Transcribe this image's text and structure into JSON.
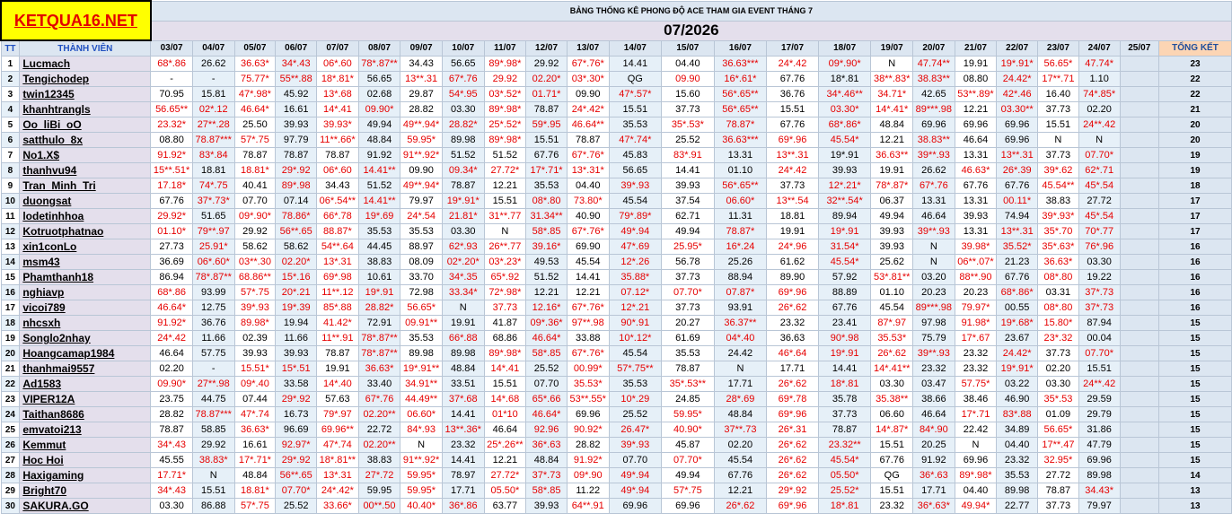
{
  "site_logo": "KETQUA16.NET",
  "subtitle": "BẢNG THỐNG KÊ PHONG ĐỘ ACE THAM GIA EVENT THÁNG 7",
  "month": "07/2026",
  "headers": {
    "tt": "TT",
    "member": "THÀNH VIÊN",
    "dates": [
      "03/07",
      "04/07",
      "05/07",
      "06/07",
      "07/07",
      "08/07",
      "09/07",
      "10/07",
      "11/07",
      "12/07",
      "13/07",
      "14/07",
      "15/07",
      "16/07",
      "17/07",
      "18/07",
      "19/07",
      "20/07",
      "21/07",
      "22/07",
      "23/07",
      "24/07",
      "25/07"
    ],
    "total": "TỔNG KẾT"
  },
  "colors": {
    "red": "#e60000",
    "black": "#000000",
    "header_blue": "#2050c0",
    "name_bg": "#e4dfec",
    "logo_bg": "#ffff00"
  },
  "rows": [
    {
      "tt": "1",
      "name": "Lucmach",
      "total": "23",
      "cells": [
        "r:68*.86",
        "k:26.62",
        "r:36.63*",
        "r:34*.43",
        "r:06*.60",
        "r:78*.87**",
        "k:34.43",
        "k:56.65",
        "r:89*.98*",
        "k:29.92",
        "r:67*.76*",
        "k:14.41",
        "k:04.40",
        "r:36.63***",
        "r:24*.42",
        "r:09*.90*",
        "k:N",
        "r:47.74**",
        "k:19.91",
        "r:19*.91*",
        "r:56.65*",
        "r:47.74*"
      ]
    },
    {
      "tt": "2",
      "name": "Tengichodep",
      "total": "22",
      "cells": [
        "k:-",
        "k:-",
        "r:75.77*",
        "r:55**.88",
        "r:18*.81*",
        "k:56.65",
        "r:13**.31",
        "r:67*.76",
        "r:29.92",
        "r:02.20*",
        "r:03*.30*",
        "k:QG",
        "r:09.90",
        "r:16*.61*",
        "k:67.76",
        "k:18*.81",
        "r:38**.83*",
        "r:38.83**",
        "k:08.80",
        "r:24.42*",
        "r:17**.71",
        "k:1.10"
      ]
    },
    {
      "tt": "3",
      "name": "twin12345",
      "total": "22",
      "cells": [
        "k:70.95",
        "k:15.81",
        "r:47*.98*",
        "k:45.92",
        "r:13*.68",
        "k:02.68",
        "k:29.87",
        "r:54*.95",
        "r:03*.52*",
        "r:01.71*",
        "k:09.90",
        "r:47*.57*",
        "k:15.60",
        "r:56*.65**",
        "k:36.76",
        "r:34*.46**",
        "r:34.71*",
        "k:42.65",
        "r:53**.89*",
        "r:42*.46",
        "k:16.40",
        "r:74*.85*"
      ]
    },
    {
      "tt": "4",
      "name": "khanhtrangls",
      "total": "21",
      "cells": [
        "r:56.65**",
        "r:02*.12",
        "r:46.64*",
        "k:16.61",
        "r:14*.41",
        "r:09.90*",
        "k:28.82",
        "k:03.30",
        "r:89*.98*",
        "k:78.87",
        "r:24*.42*",
        "k:15.51",
        "k:37.73",
        "r:56*.65**",
        "k:15.51",
        "r:03.30*",
        "r:14*.41*",
        "r:89***.98",
        "k:12.21",
        "r:03.30**",
        "k:37.73",
        "k:02.20"
      ]
    },
    {
      "tt": "5",
      "name": "Oo_liBi_oO",
      "total": "20",
      "cells": [
        "r:23.32*",
        "r:27**.28",
        "k:25.50",
        "k:39.93",
        "r:39.93*",
        "k:49.94",
        "r:49**.94*",
        "r:28.82*",
        "r:25*.52*",
        "r:59*.95",
        "r:46.64**",
        "k:35.53",
        "r:35*.53*",
        "r:78.87*",
        "k:67.76",
        "r:68*.86*",
        "k:48.84",
        "k:69.96",
        "k:69.96",
        "k:69.96",
        "k:15.51",
        "r:24**.42"
      ]
    },
    {
      "tt": "6",
      "name": "satthulo_8x",
      "total": "20",
      "cells": [
        "k:08.80",
        "r:78.87***",
        "r:57*.75",
        "k:97.79",
        "r:11**.66*",
        "k:48.84",
        "r:59.95*",
        "k:89.98",
        "r:89*.98*",
        "k:15.51",
        "k:78.87",
        "r:47*.74*",
        "k:25.52",
        "r:36.63***",
        "r:69*.96",
        "r:45.54*",
        "k:12.21",
        "r:38.83**",
        "k:46.64",
        "k:69.96",
        "k:N",
        "k:N"
      ]
    },
    {
      "tt": "7",
      "name": "No1.X$",
      "total": "19",
      "cells": [
        "r:91.92*",
        "r:83*.84",
        "k:78.87",
        "k:78.87",
        "k:78.87",
        "k:91.92",
        "r:91**.92*",
        "k:51.52",
        "k:51.52",
        "k:67.76",
        "r:67*.76*",
        "k:45.83",
        "r:83*.91",
        "k:13.31",
        "r:13**.31",
        "k:19*.91",
        "r:36.63**",
        "r:39**.93",
        "k:13.31",
        "r:13**.31",
        "k:37.73",
        "r:07.70*"
      ]
    },
    {
      "tt": "8",
      "name": "thanhvu94",
      "total": "19",
      "cells": [
        "r:15**.51*",
        "k:18.81",
        "r:18.81*",
        "r:29*.92",
        "r:06*.60",
        "r:14.41**",
        "k:09.90",
        "r:09.34*",
        "r:27.72*",
        "r:17*.71*",
        "r:13*.31*",
        "k:56.65",
        "k:14.41",
        "k:01.10",
        "r:24*.42",
        "k:39.93",
        "k:19.91",
        "k:26.62",
        "r:46.63*",
        "r:26*.39",
        "r:39*.62",
        "r:62*.71"
      ]
    },
    {
      "tt": "9",
      "name": "Tran_Minh_Tri",
      "total": "18",
      "cells": [
        "r:17.18*",
        "r:74*.75",
        "k:40.41",
        "r:89*.98",
        "k:34.43",
        "k:51.52",
        "r:49**.94*",
        "k:78.87",
        "k:12.21",
        "k:35.53",
        "k:04.40",
        "r:39*.93",
        "k:39.93",
        "r:56*.65**",
        "k:37.73",
        "r:12*.21*",
        "r:78*.87*",
        "r:67*.76",
        "k:67.76",
        "k:67.76",
        "r:45.54**",
        "r:45*.54"
      ]
    },
    {
      "tt": "10",
      "name": "duongsat",
      "total": "17",
      "cells": [
        "k:67.76",
        "r:37*.73*",
        "k:07.70",
        "k:07.14",
        "r:06*.54**",
        "r:14.41**",
        "k:79.97",
        "r:19*.91*",
        "k:15.51",
        "r:08*.80",
        "r:73.80*",
        "k:45.54",
        "k:37.54",
        "r:06.60*",
        "r:13**.54",
        "r:32**.54*",
        "k:06.37",
        "k:13.31",
        "k:13.31",
        "r:00.11*",
        "k:38.83",
        "k:27.72"
      ]
    },
    {
      "tt": "11",
      "name": "lodetinhhoa",
      "total": "17",
      "cells": [
        "r:29.92*",
        "k:51.65",
        "r:09*.90*",
        "r:78.86*",
        "r:66*.78",
        "r:19*.69",
        "r:24*.54",
        "r:21.81*",
        "r:31**.77",
        "r:31.34**",
        "k:40.90",
        "r:79*.89*",
        "k:62.71",
        "k:11.31",
        "k:18.81",
        "k:89.94",
        "k:49.94",
        "k:46.64",
        "k:39.93",
        "k:74.94",
        "r:39*.93*",
        "r:45*.54"
      ]
    },
    {
      "tt": "12",
      "name": "Kotruotphatnao",
      "total": "17",
      "cells": [
        "r:01.10*",
        "r:79**.97",
        "k:29.92",
        "r:56**.65",
        "r:88.87*",
        "k:35.53",
        "k:35.53",
        "k:03.30",
        "k:N",
        "r:58*.85",
        "r:67*.76*",
        "r:49*.94",
        "k:49.94",
        "r:78.87*",
        "k:19.91",
        "r:19*.91",
        "k:39.93",
        "r:39**.93",
        "k:13.31",
        "r:13**.31",
        "r:35*.70",
        "r:70*.77"
      ]
    },
    {
      "tt": "13",
      "name": "xin1conLo",
      "total": "16",
      "cells": [
        "k:27.73",
        "r:25.91*",
        "k:58.62",
        "k:58.62",
        "r:54**.64",
        "k:44.45",
        "k:88.97",
        "r:62*.93",
        "r:26**.77",
        "r:39.16*",
        "k:69.90",
        "r:47*.69",
        "r:25.95*",
        "r:16*.24",
        "r:24*.96",
        "r:31.54*",
        "k:39.93",
        "k:N",
        "r:39.98*",
        "r:35.52*",
        "r:35*.63*",
        "r:76*.96"
      ]
    },
    {
      "tt": "14",
      "name": "msm43",
      "total": "16",
      "cells": [
        "k:36.69",
        "r:06*.60*",
        "r:03**.30",
        "r:02.20*",
        "r:13*.31",
        "k:38.83",
        "k:08.09",
        "r:02*.20*",
        "r:03*.23*",
        "k:49.53",
        "k:45.54",
        "r:12*.26",
        "k:56.78",
        "k:25.26",
        "k:61.62",
        "r:45.54*",
        "k:25.62",
        "k:N",
        "r:06**.07*",
        "k:21.23",
        "r:36.63*",
        "k:03.30"
      ]
    },
    {
      "tt": "15",
      "name": "Phamthanh18",
      "total": "16",
      "cells": [
        "k:86.94",
        "r:78*.87**",
        "r:68.86**",
        "r:15*.16",
        "r:69*.98",
        "k:10.61",
        "k:33.70",
        "r:34*.35",
        "r:65*.92",
        "k:51.52",
        "k:14.41",
        "r:35.88*",
        "k:37.73",
        "k:88.94",
        "k:89.90",
        "k:57.92",
        "r:53*.81**",
        "k:03.20",
        "r:88**.90",
        "k:67.76",
        "r:08*.80",
        "k:19.22"
      ]
    },
    {
      "tt": "16",
      "name": "nghiavp",
      "total": "16",
      "cells": [
        "r:68*.86",
        "k:93.99",
        "r:57*.75",
        "r:20*.21",
        "r:11**.12",
        "r:19*.91",
        "k:72.98",
        "r:33.34*",
        "r:72*.98*",
        "k:12.21",
        "k:12.21",
        "r:07.12*",
        "r:07.70*",
        "r:07.87*",
        "r:69*.96",
        "k:88.89",
        "k:01.10",
        "k:20.23",
        "k:20.23",
        "r:68*.86*",
        "k:03.31",
        "r:37*.73"
      ]
    },
    {
      "tt": "17",
      "name": "vicoi789",
      "total": "16",
      "cells": [
        "r:46.64*",
        "k:12.75",
        "r:39*.93",
        "r:19*.39",
        "r:85*.88",
        "r:28.82*",
        "r:56.65*",
        "k:N",
        "r:37.73",
        "r:12.16*",
        "r:67*.76*",
        "r:12*.21",
        "k:37.73",
        "k:93.91",
        "r:26*.62",
        "k:67.76",
        "k:45.54",
        "r:89***.98",
        "r:79.97*",
        "k:00.55",
        "r:08*.80",
        "r:37*.73"
      ]
    },
    {
      "tt": "18",
      "name": "nhcsxh",
      "total": "15",
      "cells": [
        "r:91.92*",
        "k:36.76",
        "r:89.98*",
        "k:19.94",
        "r:41.42*",
        "k:72.91",
        "r:09.91**",
        "k:19.91",
        "k:41.87",
        "r:09*.36*",
        "r:97**.98",
        "r:90*.91",
        "k:20.27",
        "r:36.37**",
        "k:23.32",
        "k:23.41",
        "r:87*.97",
        "k:97.98",
        "r:91.98*",
        "r:19*.68*",
        "r:15.80*",
        "k:87.94"
      ]
    },
    {
      "tt": "19",
      "name": "Songlo2nhay",
      "total": "15",
      "cells": [
        "r:24*.42",
        "k:11.66",
        "k:02.39",
        "k:11.66",
        "r:11**.91",
        "r:78*.87**",
        "k:35.53",
        "r:66*.88",
        "k:68.86",
        "r:46.64*",
        "k:33.88",
        "r:10*.12*",
        "k:61.69",
        "r:04*.40",
        "k:36.63",
        "r:90*.98",
        "r:35.53*",
        "k:75.79",
        "r:17*.67",
        "k:23.67",
        "r:23*.32",
        "k:00.04"
      ]
    },
    {
      "tt": "20",
      "name": "Hoangcamap1984",
      "total": "15",
      "cells": [
        "k:46.64",
        "k:57.75",
        "k:39.93",
        "k:39.93",
        "k:78.87",
        "r:78*.87**",
        "k:89.98",
        "k:89.98",
        "r:89*.98*",
        "r:58*.85",
        "r:67*.76*",
        "k:45.54",
        "k:35.53",
        "k:24.42",
        "r:46*.64",
        "r:19*.91",
        "r:26*.62",
        "r:39**.93",
        "k:23.32",
        "r:24.42*",
        "k:37.73",
        "r:07.70*"
      ]
    },
    {
      "tt": "21",
      "name": "thanhmai9557",
      "total": "15",
      "cells": [
        "k:02.20",
        "k:-",
        "r:15.51*",
        "r:15*.51",
        "k:19.91",
        "r:36.63*",
        "r:19*.91**",
        "k:48.84",
        "r:14*.41",
        "k:25.52",
        "r:00.99*",
        "r:57*.75**",
        "k:78.87",
        "k:N",
        "k:17.71",
        "k:14.41",
        "r:14*.41**",
        "k:23.32",
        "k:23.32",
        "r:19*.91*",
        "k:02.20",
        "k:15.51"
      ]
    },
    {
      "tt": "22",
      "name": "Ad1583",
      "total": "15",
      "cells": [
        "r:09.90*",
        "r:27**.98",
        "r:09*.40",
        "k:33.58",
        "r:14*.40",
        "k:33.40",
        "r:34.91**",
        "k:33.51",
        "k:15.51",
        "k:07.70",
        "r:35.53*",
        "k:35.53",
        "r:35*.53**",
        "k:17.71",
        "r:26*.62",
        "r:18*.81",
        "k:03.30",
        "k:03.47",
        "r:57.75*",
        "k:03.22",
        "k:03.30",
        "r:24**.42"
      ]
    },
    {
      "tt": "23",
      "name": "VIPER12A",
      "total": "15",
      "cells": [
        "k:23.75",
        "k:44.75",
        "k:07.44",
        "r:29*.92",
        "k:57.63",
        "r:67*.76",
        "r:44.49**",
        "r:37*.68",
        "r:14*.68",
        "r:65*.66",
        "r:53**.55*",
        "r:10*.29",
        "k:24.85",
        "r:28*.69",
        "r:69*.78",
        "k:35.78",
        "r:35.38**",
        "k:38.66",
        "k:38.46",
        "k:46.90",
        "r:35*.53",
        "k:29.59"
      ]
    },
    {
      "tt": "24",
      "name": "Taithan8686",
      "total": "15",
      "cells": [
        "k:28.82",
        "r:78.87***",
        "r:47*.74",
        "k:16.73",
        "r:79*.97",
        "r:02.20**",
        "r:06.60*",
        "k:14.41",
        "r:01*10",
        "r:46.64*",
        "k:69.96",
        "k:25.52",
        "r:59.95*",
        "k:48.84",
        "r:69*.96",
        "k:37.73",
        "k:06.60",
        "k:46.64",
        "r:17*.71",
        "r:83*.88",
        "k:01.09",
        "k:29.79"
      ]
    },
    {
      "tt": "25",
      "name": "emvatoi213",
      "total": "15",
      "cells": [
        "k:78.87",
        "k:58.85",
        "r:36.63*",
        "k:96.69",
        "r:69.96**",
        "k:22.72",
        "r:84*.93",
        "r:13**.36*",
        "k:46.64",
        "r:92.96",
        "r:90.92*",
        "r:26.47*",
        "r:40.90*",
        "r:37**.73",
        "r:26*.31",
        "k:78.87",
        "r:14*.87*",
        "r:84*.90",
        "k:22.42",
        "k:34.89",
        "r:56.65*",
        "k:31.86"
      ]
    },
    {
      "tt": "26",
      "name": "Kemmut",
      "total": "15",
      "cells": [
        "r:34*.43",
        "k:29.92",
        "k:16.61",
        "r:92.97*",
        "r:47*.74",
        "r:02.20**",
        "k:N",
        "k:23.32",
        "r:25*.26**",
        "r:36*.63",
        "k:28.82",
        "r:39*.93",
        "k:45.87",
        "k:02.20",
        "r:26*.62",
        "r:23.32**",
        "k:15.51",
        "k:20.25",
        "k:N",
        "k:04.40",
        "r:17**.47",
        "k:47.79"
      ]
    },
    {
      "tt": "27",
      "name": "Hoc Hoi",
      "total": "15",
      "cells": [
        "k:45.55",
        "r:38.83*",
        "r:17*.71*",
        "r:29*.92",
        "r:18*.81**",
        "k:38.83",
        "r:91**.92*",
        "k:14.41",
        "k:12.21",
        "k:48.84",
        "r:91.92*",
        "k:07.70",
        "r:07.70*",
        "k:45.54",
        "r:26*.62",
        "r:45.54*",
        "k:67.76",
        "k:91.92",
        "k:69.96",
        "k:23.32",
        "r:32.95*",
        "k:69.96"
      ]
    },
    {
      "tt": "28",
      "name": "Haxigaming",
      "total": "14",
      "cells": [
        "r:17.71*",
        "k:N",
        "k:48.84",
        "r:56**.65",
        "r:13*.31",
        "r:27*.72",
        "r:59.95*",
        "k:78.97",
        "r:27.72*",
        "r:37*.73",
        "r:09*.90",
        "r:49*.94",
        "k:49.94",
        "k:67.76",
        "r:26*.62",
        "r:05.50*",
        "k:QG",
        "r:36*.63",
        "r:89*.98*",
        "k:35.53",
        "k:27.72",
        "k:89.98"
      ]
    },
    {
      "tt": "29",
      "name": "Bright70",
      "total": "13",
      "cells": [
        "r:34*.43",
        "k:15.51",
        "r:18.81*",
        "r:07.70*",
        "r:24*.42*",
        "k:59.95",
        "r:59.95*",
        "k:17.71",
        "r:05.50*",
        "r:58*.85",
        "k:11.22",
        "r:49*.94",
        "r:57*.75",
        "k:12.21",
        "r:29*.92",
        "r:25.52*",
        "k:15.51",
        "k:17.71",
        "k:04.40",
        "k:89.98",
        "k:78.87",
        "r:34.43*"
      ]
    },
    {
      "tt": "30",
      "name": "SAKURA.GO",
      "total": "13",
      "cells": [
        "k:03.30",
        "k:86.88",
        "r:57*.75",
        "k:25.52",
        "r:33.66*",
        "r:00**.50",
        "r:40.40*",
        "r:36*.86",
        "k:63.77",
        "k:39.93",
        "r:64**.91",
        "k:69.96",
        "k:69.96",
        "r:26*.62",
        "r:69*.96",
        "r:18*.81",
        "k:23.32",
        "r:36*.63*",
        "r:49.94*",
        "k:22.77",
        "k:37.73",
        "k:79.97"
      ]
    }
  ]
}
